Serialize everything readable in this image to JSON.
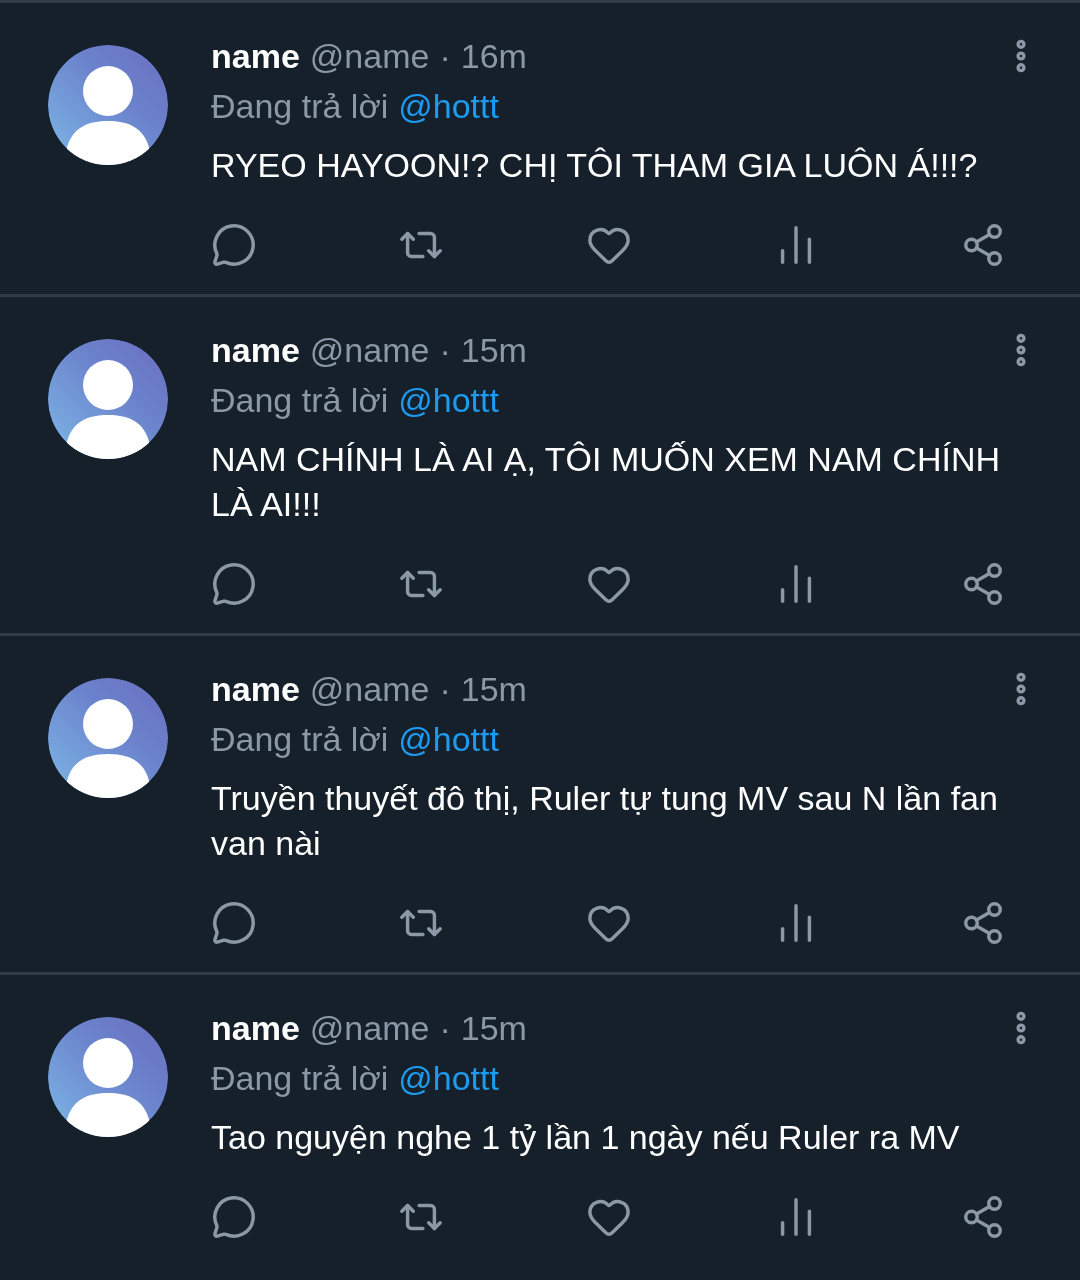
{
  "tweets": [
    {
      "name": "name",
      "handle": "@name",
      "separator": "·",
      "time": "16m",
      "reply_prefix": "Đang trả lời",
      "reply_to": "@hottt",
      "text": "RYEO HAYOON!? CHỊ TÔI THAM GIA LUÔN Á!!!?"
    },
    {
      "name": "name",
      "handle": "@name",
      "separator": "·",
      "time": "15m",
      "reply_prefix": "Đang trả lời",
      "reply_to": "@hottt",
      "text": "NAM CHÍNH LÀ AI Ạ, TÔI MUỐN XEM NAM CHÍNH LÀ AI!!!"
    },
    {
      "name": "name",
      "handle": "@name",
      "separator": "·",
      "time": "15m",
      "reply_prefix": "Đang trả lời",
      "reply_to": "@hottt",
      "text": "Truyền thuyết đô thị, Ruler tự tung MV sau N lần fan van nài"
    },
    {
      "name": "name",
      "handle": "@name",
      "separator": "·",
      "time": "15m",
      "reply_prefix": "Đang trả lời",
      "reply_to": "@hottt",
      "text": "Tao nguyện nghe 1 tỷ lần 1 ngày nếu Ruler ra MV"
    }
  ]
}
